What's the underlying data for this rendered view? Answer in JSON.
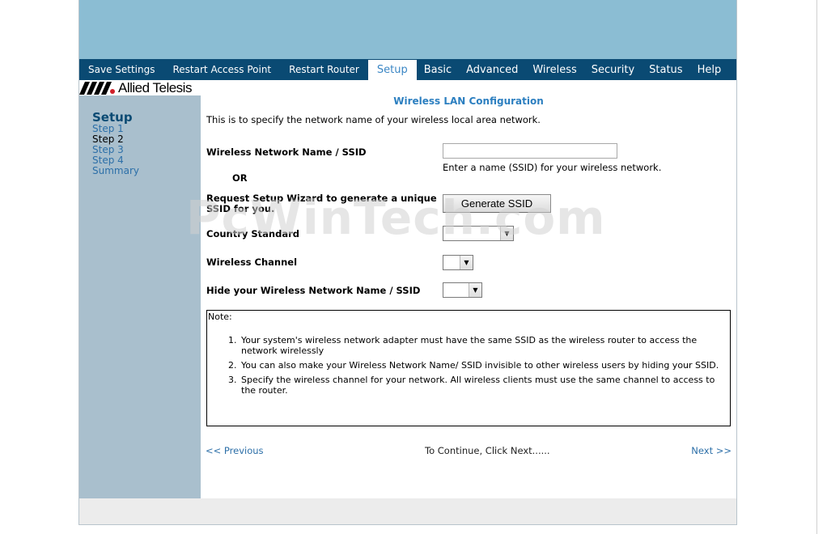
{
  "nav": {
    "items": [
      "Save Settings",
      "Restart Access Point",
      "Restart Router",
      "Setup",
      "Basic",
      "Advanced",
      "Wireless",
      "Security",
      "Status",
      "Help"
    ],
    "active": "Setup"
  },
  "logo": {
    "brand": "Allied Telesis"
  },
  "sidebar": {
    "title": "Setup",
    "steps": [
      "Step 1",
      "Step 2",
      "Step 3",
      "Step 4",
      "Summary"
    ],
    "current": "Step 2"
  },
  "main": {
    "heading": "Wireless LAN Configuration",
    "intro": "This is to specify the network name of your wireless local area network.",
    "ssid_label": "Wireless Network Name / SSID",
    "ssid_hint": "Enter a name (SSID) for your wireless network.",
    "or_text": "OR",
    "wizard_label_line1": "Request Setup Wizard to generate a unique",
    "wizard_label_line2": "SSID for you.",
    "generate_button": "Generate SSID",
    "country_label": "Country Standard",
    "country_value": "",
    "channel_label": "Wireless Channel",
    "channel_value": "",
    "hide_label": "Hide your Wireless Network Name / SSID",
    "hide_value": ""
  },
  "note": {
    "label": "Note:",
    "items": [
      "Your system's wireless network adapter must have the same SSID as the wireless router to access the network wirelessly",
      "You can also make your Wireless Network Name/ SSID invisible to other wireless users by hiding your SSID.",
      "Specify the wireless channel for your network. All wireless clients must use the same channel to access to the router."
    ]
  },
  "footer": {
    "previous": "<< Previous",
    "continue_text": "To Continue, Click Next......",
    "next": "Next >>"
  },
  "watermark": "PcWinTech.com",
  "colors": {
    "nav_bg": "#0a4a73",
    "banner": "#8bbdd3",
    "sidebar": "#a9bfcd",
    "link": "#2c6fa8",
    "heading": "#2c7fc0"
  }
}
